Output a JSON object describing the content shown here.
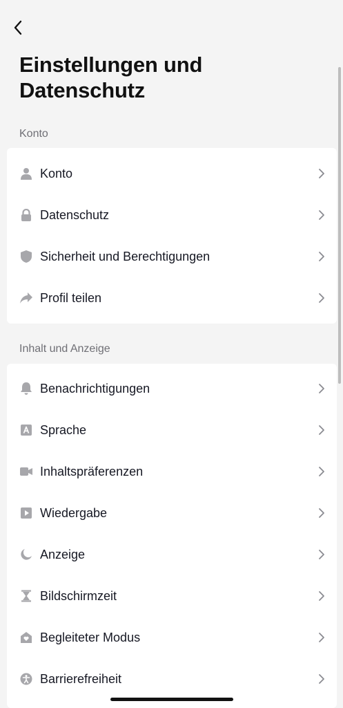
{
  "header": {
    "title": "Einstellungen und Datenschutz"
  },
  "sections": [
    {
      "label": "Konto",
      "items": [
        {
          "label": "Konto",
          "icon": "person-icon"
        },
        {
          "label": "Datenschutz",
          "icon": "lock-icon"
        },
        {
          "label": "Sicherheit und Berechtigungen",
          "icon": "shield-icon"
        },
        {
          "label": "Profil teilen",
          "icon": "share-arrow-icon"
        }
      ]
    },
    {
      "label": "Inhalt und Anzeige",
      "items": [
        {
          "label": "Benachrichtigungen",
          "icon": "bell-icon"
        },
        {
          "label": "Sprache",
          "icon": "language-a-icon"
        },
        {
          "label": "Inhaltspräferenzen",
          "icon": "video-camera-icon"
        },
        {
          "label": "Wiedergabe",
          "icon": "play-square-icon"
        },
        {
          "label": "Anzeige",
          "icon": "moon-icon"
        },
        {
          "label": "Bildschirmzeit",
          "icon": "hourglass-icon"
        },
        {
          "label": "Begleiteter Modus",
          "icon": "house-heart-icon"
        },
        {
          "label": "Barrierefreiheit",
          "icon": "accessibility-icon"
        }
      ]
    }
  ],
  "colors": {
    "background": "#f4f4f4",
    "card": "#ffffff",
    "icon_gray": "#a7a7ab",
    "text": "#161823",
    "section_label": "#6f6f75"
  }
}
